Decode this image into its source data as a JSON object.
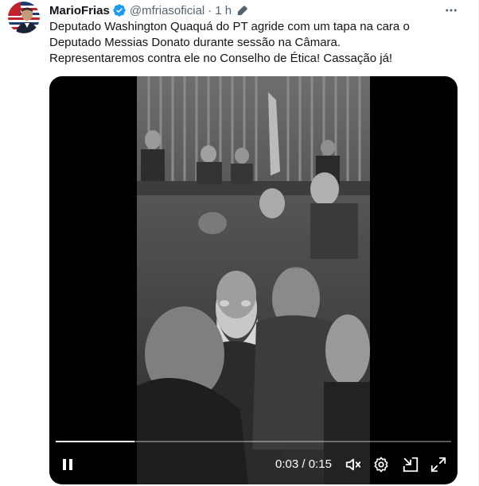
{
  "author": {
    "name": "MarioFrias",
    "handle": "@mfriasoficial",
    "separator": "·",
    "time": "1 h"
  },
  "tweet": {
    "lines": [
      "Deputado Washington Quaquá do PT agride com um tapa na cara o",
      "Deputado Messias Donato durante sessão na Câmara.",
      "Representaremos contra ele no Conselho de Ética! Cassação já!"
    ]
  },
  "video": {
    "current_time": "0:03",
    "duration": "0:15",
    "time_separator": " / ",
    "progress": 0.2
  },
  "icons": {
    "verified": "verified-badge-icon",
    "edited": "edited-pencil-icon",
    "more": "more-dots-icon",
    "pause": "pause-icon",
    "mute": "volume-muted-icon",
    "settings": "gear-icon",
    "minimize": "picture-in-picture-icon",
    "fullscreen": "fullscreen-icon"
  },
  "colors": {
    "verified": "#1d9bf0",
    "secondary_text": "#536471",
    "primary_text": "#0f1419",
    "video_background": "#000000"
  }
}
